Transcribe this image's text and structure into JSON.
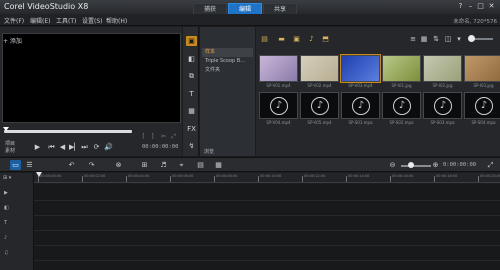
{
  "window": {
    "title": "Corel VideoStudio X8",
    "mode_tabs": [
      "捕获",
      "编辑",
      "共享"
    ],
    "active_tab": "编辑",
    "controls": [
      "?",
      "–",
      "□",
      "✕"
    ]
  },
  "menu": {
    "items": [
      "文件(F)",
      "编辑(E)",
      "工具(T)",
      "设置(S)",
      "帮助(H)"
    ],
    "project_info": "未命名, 720*576"
  },
  "preview": {
    "mode_project": "项目",
    "mode_clip": "素材",
    "timecode": "00:00:00:00",
    "controls": [
      "⏮",
      "◀",
      "▶",
      "⏭",
      "⟳",
      "🔊"
    ]
  },
  "library": {
    "categories": [
      "media",
      "instant-project",
      "transition",
      "title",
      "graphics",
      "filter",
      "path"
    ],
    "cat_glyphs": [
      "▣",
      "◧",
      "⧉",
      "T",
      "▦",
      "FX",
      "↯"
    ],
    "add_label": "+ 添加",
    "folders": [
      "样本",
      "Triple Scoop B...",
      "文件夹"
    ],
    "browse_label": "浏览",
    "thumbs": [
      {
        "label": "SP-V01.mp4",
        "kind": "video",
        "colors": [
          "#c9b7d9",
          "#8a7aa9"
        ]
      },
      {
        "label": "SP-V02.mp4",
        "kind": "video",
        "colors": [
          "#d6cfbb",
          "#b6ad92"
        ]
      },
      {
        "label": "SP-V03.mp4",
        "kind": "video",
        "colors": [
          "#1e3fae",
          "#5a7fe0"
        ]
      },
      {
        "label": "SP-I01.jpg",
        "kind": "image",
        "colors": [
          "#b8c98a",
          "#7d8f3a"
        ]
      },
      {
        "label": "SP-I02.jpg",
        "kind": "image",
        "colors": [
          "#c6c9b1",
          "#9aa07a"
        ]
      },
      {
        "label": "SP-I03.jpg",
        "kind": "image",
        "colors": [
          "#c0996b",
          "#8f6a3c"
        ]
      },
      {
        "label": "SP-V04.mp4",
        "kind": "audio",
        "colors": [
          "#0b0c0e",
          "#0b0c0e"
        ]
      },
      {
        "label": "SP-V05.mp4",
        "kind": "audio",
        "colors": [
          "#0b0c0e",
          "#0b0c0e"
        ]
      },
      {
        "label": "SP-S01.mpa",
        "kind": "audio",
        "colors": [
          "#0b0c0e",
          "#0b0c0e"
        ]
      },
      {
        "label": "SP-S02.mpa",
        "kind": "audio",
        "colors": [
          "#0b0c0e",
          "#0b0c0e"
        ]
      },
      {
        "label": "SP-S03.mpa",
        "kind": "audio",
        "colors": [
          "#0b0c0e",
          "#0b0c0e"
        ]
      },
      {
        "label": "SP-S04.mpa",
        "kind": "audio",
        "colors": [
          "#0b0c0e",
          "#0b0c0e"
        ]
      }
    ]
  },
  "timeline": {
    "duration": "0:00:00:00",
    "ruler_labels": [
      "00:00:00:00",
      "00:00:02:00",
      "00:00:04:00",
      "00:00:06:00",
      "00:00:08:00",
      "00:00:10:00",
      "00:00:12:00",
      "00:00:14:00",
      "00:00:16:00",
      "00:00:18:00",
      "00:00:20:00"
    ],
    "tracks": [
      "video",
      "overlay",
      "title",
      "voice",
      "music"
    ],
    "track_glyphs": [
      "▶",
      "◧",
      "T",
      "♪",
      "♫"
    ]
  },
  "accent": "#1f74c7",
  "highlight": "#c98a1d"
}
